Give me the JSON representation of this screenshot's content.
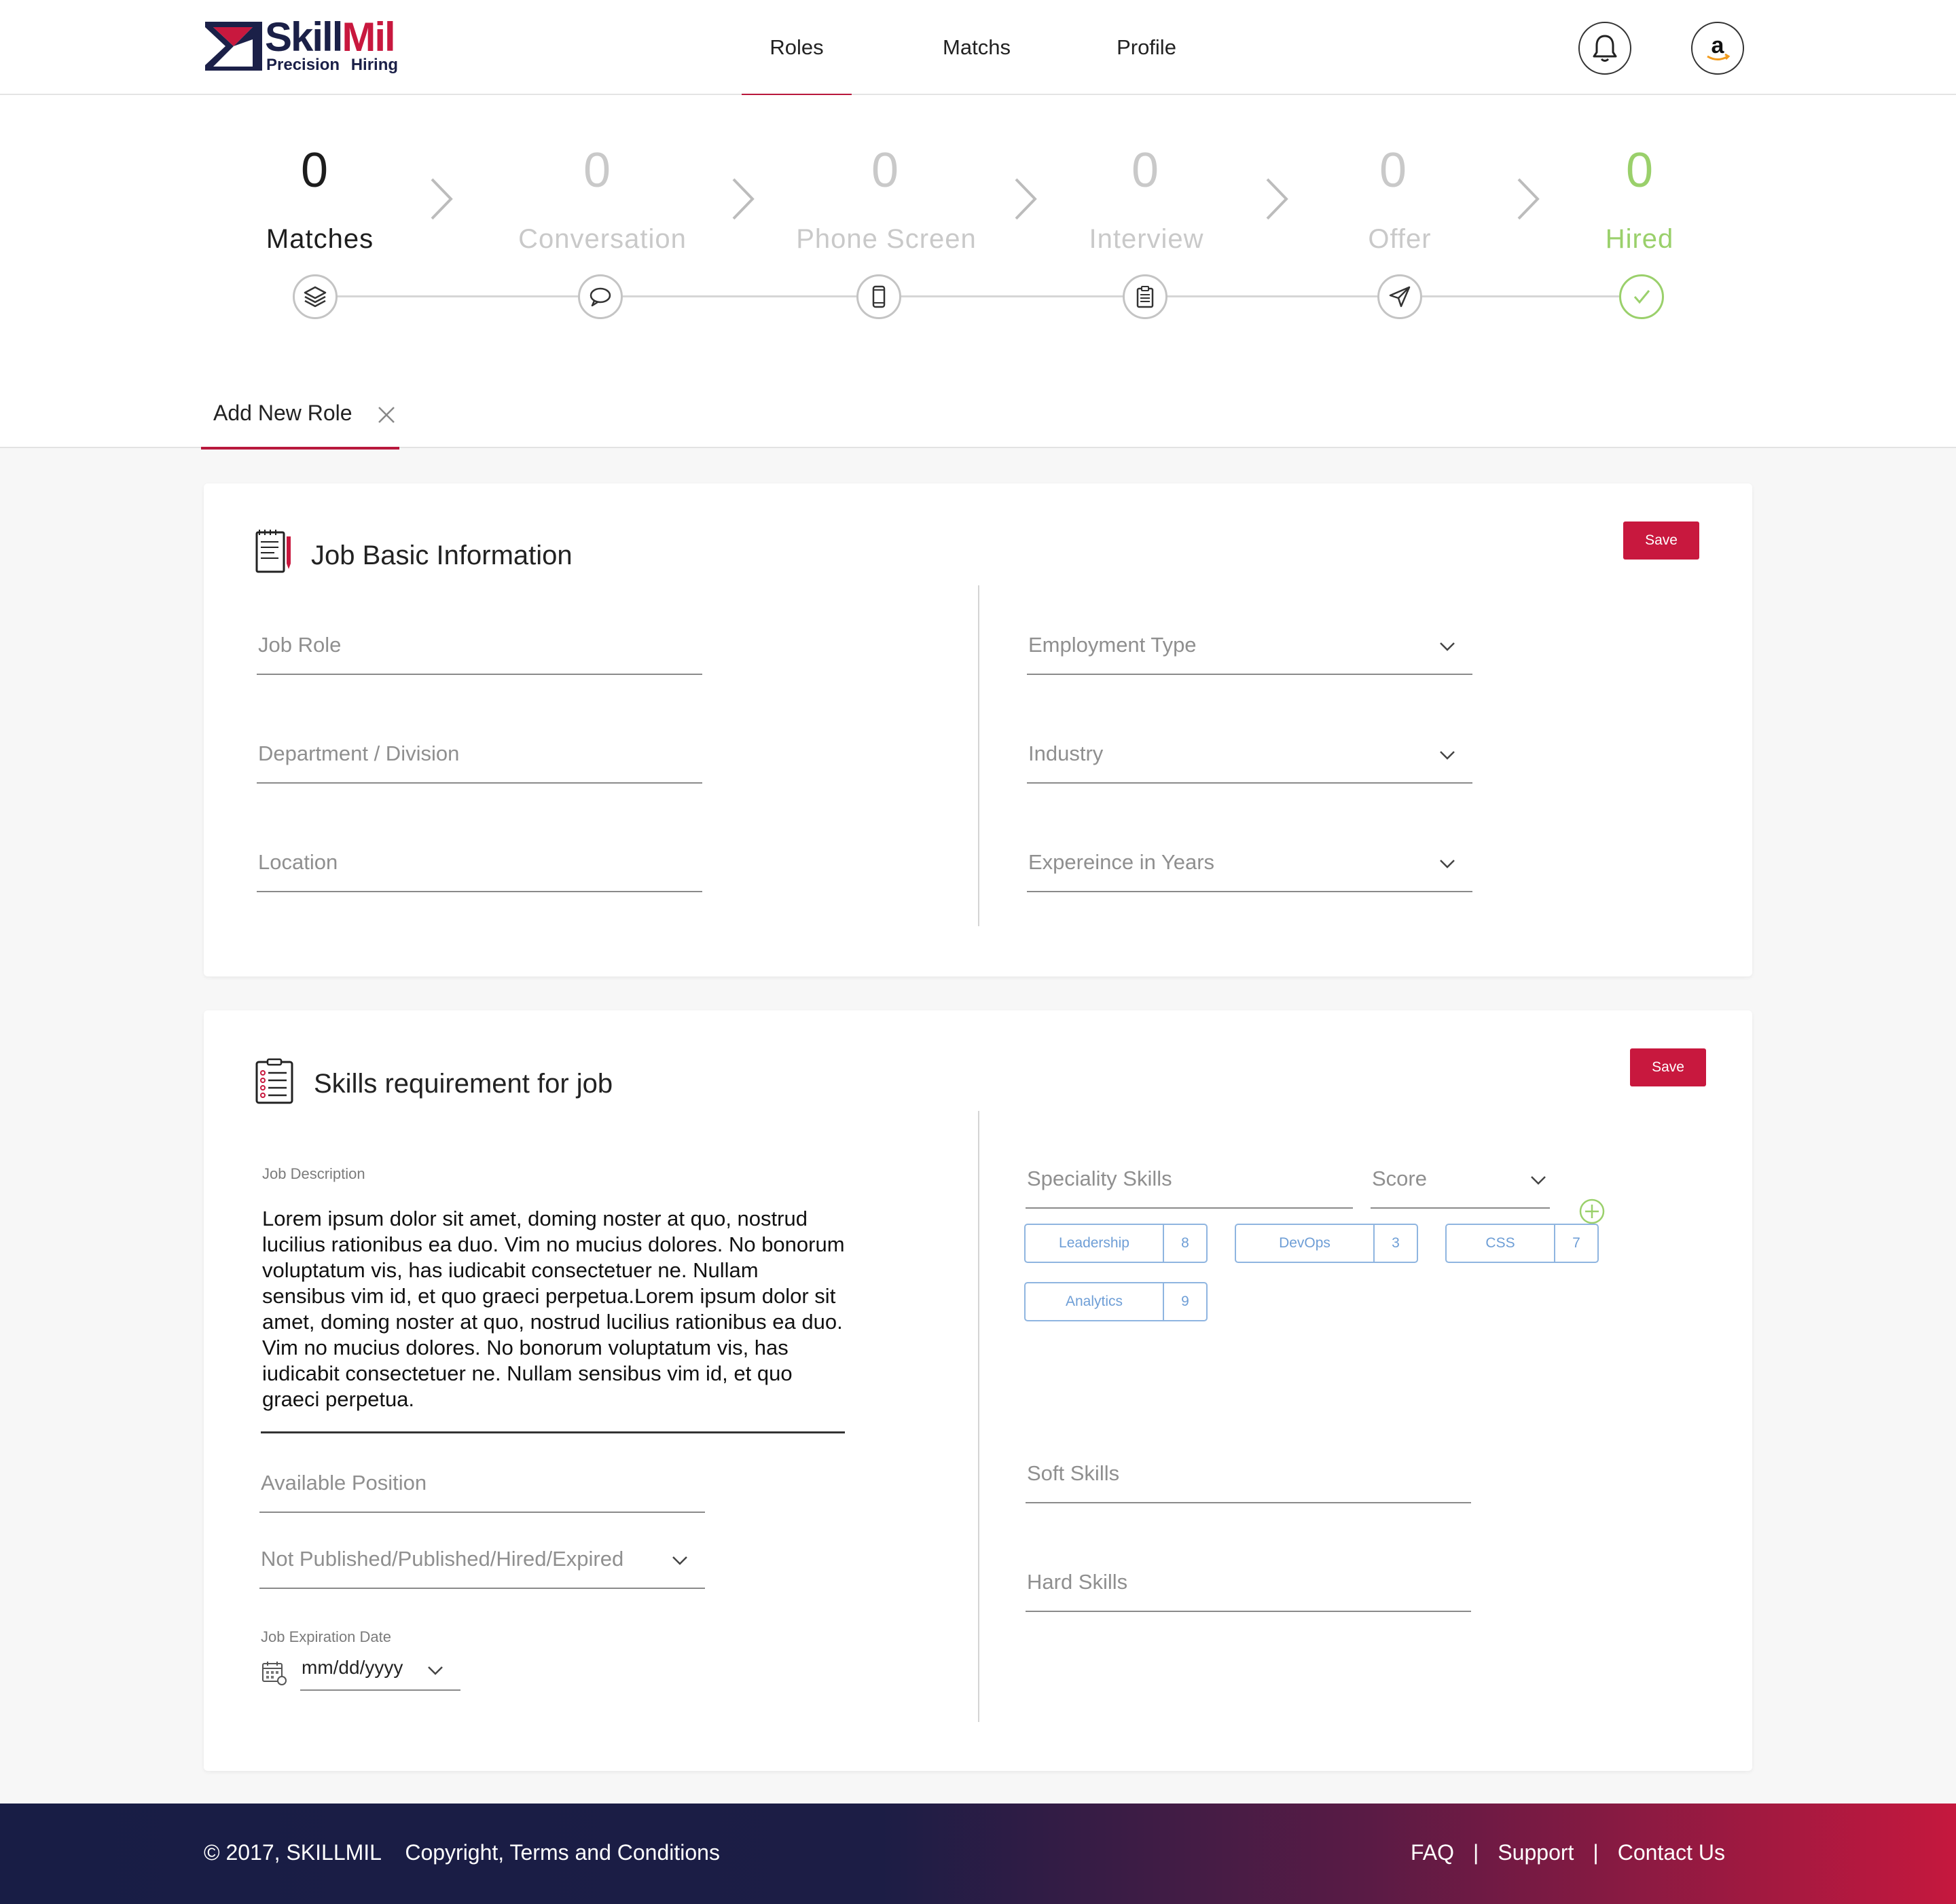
{
  "brand": {
    "name_a": "Skill",
    "name_b": "Mil",
    "tagline": "Precision Hiring"
  },
  "nav": {
    "roles": "Roles",
    "matchs": "Matchs",
    "profile": "Profile",
    "active": "Roles"
  },
  "header_icons": {
    "notifications": "bell-icon",
    "account": "amazon-logo"
  },
  "pipeline": [
    {
      "count": "0",
      "label": "Matches",
      "icon": "layers-icon"
    },
    {
      "count": "0",
      "label": "Conversation",
      "icon": "chat-icon"
    },
    {
      "count": "0",
      "label": "Phone Screen",
      "icon": "phone-icon"
    },
    {
      "count": "0",
      "label": "Interview",
      "icon": "clipboard-icon"
    },
    {
      "count": "0",
      "label": "Offer",
      "icon": "send-icon"
    },
    {
      "count": "0",
      "label": "Hired",
      "icon": "check-icon"
    }
  ],
  "tab": {
    "label": "Add New Role"
  },
  "basic": {
    "title": "Job Basic Information",
    "save": "Save",
    "job_role": "Job Role",
    "department": "Department / Division",
    "location": "Location",
    "employment_type": "Employment Type",
    "industry": "Industry",
    "experience": "Expereince in Years"
  },
  "skills": {
    "title": "Skills requirement for job",
    "save": "Save",
    "jd_label": "Job Description",
    "jd_text": "Lorem ipsum dolor sit amet, doming noster at quo, nostrud lucilius rationibus ea duo. Vim no mucius dolores. No bonorum voluptatum vis, has iudicabit consectetuer ne. Nullam sensibus vim id, et quo graeci perpetua.Lorem ipsum dolor sit amet, doming noster at quo, nostrud lucilius rationibus ea duo. Vim no mucius dolores. No bonorum voluptatum vis, has iudicabit consectetuer ne. Nullam sensibus vim id, et quo graeci perpetua.",
    "available_position": "Available Position",
    "status": "Not Published/Published/Hired/Expired",
    "expiry_label": "Job Expiration Date",
    "expiry_value": "mm/dd/yyyy",
    "speciality": "Speciality Skills",
    "score": "Score",
    "chips": [
      {
        "name": "Leadership",
        "score": "8"
      },
      {
        "name": "DevOps",
        "score": "3"
      },
      {
        "name": "CSS",
        "score": "7"
      },
      {
        "name": "Analytics",
        "score": "9"
      }
    ],
    "soft_skills": "Soft Skills",
    "hard_skills": "Hard Skills"
  },
  "footer": {
    "copyright": "© 2017, SKILLMIL    Copyright, Terms and Conditions",
    "faq": "FAQ",
    "support": "Support",
    "contact": "Contact Us",
    "separator": "|"
  },
  "colors": {
    "brand_red": "#c8183e",
    "brand_navy": "#1b2048",
    "hired_green": "#9ad06b",
    "chip_blue": "#8fb5e0"
  }
}
